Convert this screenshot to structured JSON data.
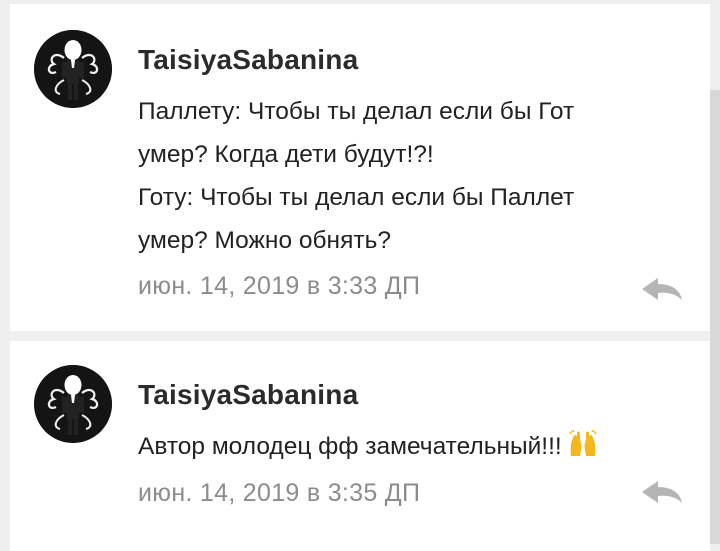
{
  "comments": [
    {
      "username": "TaisiyaSabanina",
      "avatar_icon": "slenderman-avatar",
      "lines": [
        "Паллету: Чтобы ты делал если бы Гот",
        "умер? Когда дети будут!?!",
        "Готу: Чтобы ты делал если бы Паллет",
        "умер? Можно обнять?"
      ],
      "timestamp": "июн. 14, 2019 в 3:33 ДП",
      "reply_icon": "reply-icon"
    },
    {
      "username": "TaisiyaSabanina",
      "avatar_icon": "slenderman-avatar",
      "lines": [
        "Автор молодец фф замечательный!!!"
      ],
      "emoji": "raising-hands-emoji",
      "timestamp": "июн. 14, 2019 в 3:35 ДП",
      "reply_icon": "reply-icon"
    }
  ],
  "colors": {
    "background": "#efefef",
    "card": "#ffffff",
    "username": "#2b2b2b",
    "text": "#222222",
    "timestamp": "#8c8c8c",
    "reply_icon": "#b5b5b5",
    "emoji": "#f5b81c"
  }
}
